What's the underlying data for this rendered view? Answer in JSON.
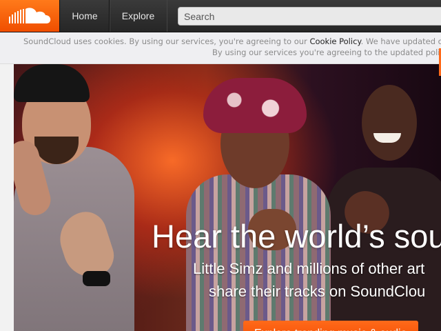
{
  "header": {
    "logo_icon": "soundcloud-cloud-icon",
    "nav": [
      {
        "label": "Home"
      },
      {
        "label": "Explore"
      }
    ],
    "search": {
      "placeholder": "Search",
      "value": ""
    }
  },
  "cookie_banner": {
    "line1_prefix": "SoundCloud uses cookies. By using our services, you're agreeing to our ",
    "cookie_link": "Cookie Policy",
    "line1_suffix": ". We have updated o",
    "line2": "By using our services you're agreeing to the updated polic"
  },
  "hero": {
    "title": "Hear the world’s sou",
    "subtitle_line1": "Little Simz and millions of other art",
    "subtitle_line2": "share their tracks on SoundClou",
    "cta_label": "Explore trending music & audio"
  },
  "colors": {
    "brand_orange": "#ff5500",
    "header_bg": "#333333",
    "banner_bg": "#efeff2"
  }
}
